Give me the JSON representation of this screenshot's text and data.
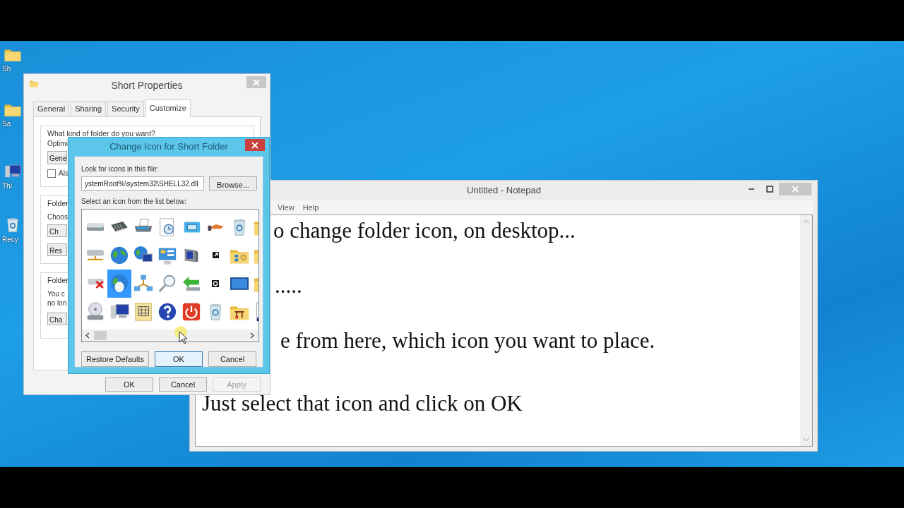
{
  "desktop_icons": [
    {
      "kind": "folder",
      "label": "Sh"
    },
    {
      "kind": "folder",
      "label": "Sa"
    },
    {
      "kind": "computer",
      "label": "Thi"
    },
    {
      "kind": "recycle-bin",
      "label": "Recy"
    }
  ],
  "notepad": {
    "title": "Untitled - Notepad",
    "menu": [
      "View",
      "Help"
    ],
    "lines": [
      "o change folder icon, on desktop...",
      ".....",
      "e from here, which icon you want to place.",
      "Just select that icon and click on OK"
    ]
  },
  "properties": {
    "title": "Short Properties",
    "tabs": [
      {
        "label": "General",
        "selected": false
      },
      {
        "label": "Sharing",
        "selected": false
      },
      {
        "label": "Security",
        "selected": false
      },
      {
        "label": "Customize",
        "selected": true
      }
    ],
    "group_1": {
      "heading": "What kind of folder do you want?",
      "text": "Optimi",
      "dropdown": "Gene",
      "checkbox": {
        "label": "Als",
        "checked": false
      }
    },
    "group_2": {
      "heading": "Folder",
      "text": "Choos",
      "buttons": [
        "Ch",
        "Res"
      ]
    },
    "group_3": {
      "heading": "Folder",
      "lines": [
        "You c",
        "no lon"
      ],
      "button": "Cha"
    },
    "buttons": [
      {
        "label": "OK",
        "disabled": false
      },
      {
        "label": "Cancel",
        "disabled": false
      },
      {
        "label": "Apply",
        "disabled": true
      }
    ]
  },
  "change_icon": {
    "title": "Change Icon for Short Folder",
    "file_label": "Look for icons in this file:",
    "file_value": "ystemRoot%\\system32\\SHELL32.dll",
    "browse": "Browse...",
    "list_label": "Select an icon from the list below:",
    "icons": [
      {
        "kind": "drive",
        "selected": false
      },
      {
        "kind": "chip",
        "selected": false
      },
      {
        "kind": "printer",
        "selected": false
      },
      {
        "kind": "clock-page",
        "selected": false
      },
      {
        "kind": "panel",
        "selected": false
      },
      {
        "kind": "hand",
        "selected": false
      },
      {
        "kind": "bin",
        "selected": false
      },
      {
        "kind": "folder",
        "selected": false
      },
      {
        "kind": "network-drive",
        "selected": false
      },
      {
        "kind": "globe",
        "selected": false
      },
      {
        "kind": "globe-monitor",
        "selected": false
      },
      {
        "kind": "dashboard",
        "selected": false
      },
      {
        "kind": "speaker",
        "selected": false
      },
      {
        "kind": "shortcut",
        "selected": false
      },
      {
        "kind": "folder-people",
        "selected": false
      },
      {
        "kind": "folder-people",
        "selected": false
      },
      {
        "kind": "drive-error",
        "selected": false
      },
      {
        "kind": "globe-mouse",
        "selected": true
      },
      {
        "kind": "network",
        "selected": false
      },
      {
        "kind": "magnifier",
        "selected": false
      },
      {
        "kind": "arrow",
        "selected": false
      },
      {
        "kind": "clock-badge",
        "selected": false
      },
      {
        "kind": "monitor",
        "selected": false
      },
      {
        "kind": "folder",
        "selected": false
      },
      {
        "kind": "cd-drive",
        "selected": false
      },
      {
        "kind": "computer",
        "selected": false
      },
      {
        "kind": "grid-page",
        "selected": false
      },
      {
        "kind": "help",
        "selected": false
      },
      {
        "kind": "power",
        "selected": false
      },
      {
        "kind": "bin",
        "selected": false
      },
      {
        "kind": "tools-folder",
        "selected": false
      },
      {
        "kind": "checklist",
        "selected": false
      }
    ],
    "buttons": [
      {
        "label": "Restore Defaults",
        "default": false
      },
      {
        "label": "OK",
        "default": true
      },
      {
        "label": "Cancel",
        "default": false
      }
    ]
  }
}
